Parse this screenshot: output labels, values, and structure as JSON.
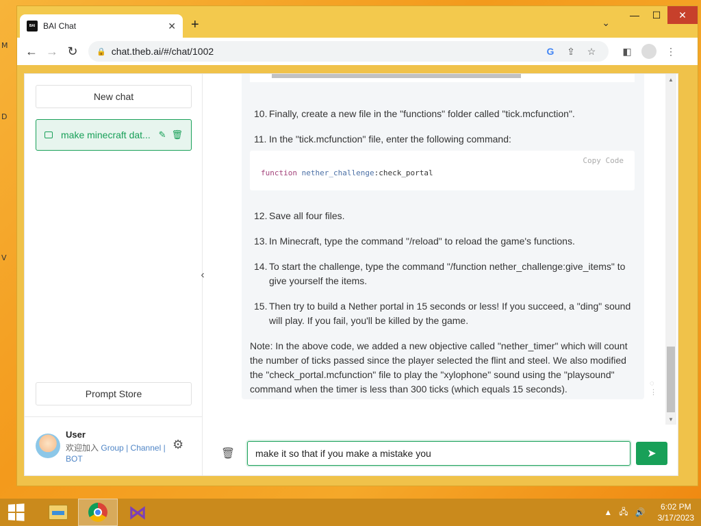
{
  "browser": {
    "tab_title": "BAI Chat",
    "tab_favicon_text": "BAI",
    "tab_close": "✕",
    "new_tab": "+",
    "tab_dropdown": "⌄",
    "win_minimize": "—",
    "win_maximize": "☐",
    "win_close": "✕",
    "url": "chat.theb.ai/#/chat/1002",
    "back": "←",
    "forward": "→",
    "reload": "↻",
    "lock": "🔒",
    "google": "G",
    "share": "⇪",
    "bookmark": "☆",
    "menu": "⋮",
    "sidepanel": "◧"
  },
  "desktop": {
    "letters": [
      "M",
      "D",
      "V"
    ]
  },
  "sidebar": {
    "new_chat": "New chat",
    "conversation_title": "make minecraft dat...",
    "edit_icon": "✎",
    "delete_icon": "🗑",
    "prompt_store": "Prompt Store",
    "user_name": "User",
    "user_prefix": "欢迎加入",
    "group_link": "Group",
    "sep1": "|",
    "channel_link": "Channel",
    "sep2": "|",
    "bot_link": "BOT",
    "settings_icon": "⚙",
    "collapse_icon": "‹"
  },
  "chat": {
    "items": [
      {
        "num": "10.",
        "text": "Finally, create a new file in the \"functions\" folder called \"tick.mcfunction\"."
      },
      {
        "num": "11.",
        "text": "In the \"tick.mcfunction\" file, enter the following command:"
      },
      {
        "num": "12.",
        "text": "Save all four files."
      },
      {
        "num": "13.",
        "text": "In Minecraft, type the command \"/reload\" to reload the game's functions."
      },
      {
        "num": "14.",
        "text": "To start the challenge, type the command \"/function nether_challenge:give_items\" to",
        "text2": "give yourself the items."
      },
      {
        "num": "15.",
        "text": "Then try to build a Nether portal in 15 seconds or less! If you succeed, a \"ding\" sound",
        "text2": "will play. If you fail, you'll be killed by the game."
      }
    ],
    "code": {
      "copy_label": "Copy Code",
      "keyword": "function",
      "namespace": "nether_challenge",
      "rest": ":check_portal"
    },
    "note_lines": [
      "Note: In the above code, we added a new objective called \"nether_timer\" which will count",
      "the number of ticks passed since the player selected the flint and steel. We also modified",
      "the \"check_portal.mcfunction\" file to play the \"xylophone\" sound using the \"playsound\"",
      "command when the timer is less than 300 ticks (which equals 15 seconds)."
    ],
    "input_value": "make it so that if you make a mistake you",
    "trash_icon": "🗑",
    "send_icon": "➤",
    "scroll_up": "▲",
    "scroll_down": "▼",
    "msg_tool_1": "◌",
    "msg_tool_2": "⋮"
  },
  "taskbar": {
    "time": "6:02 PM",
    "date": "3/17/2023",
    "tray_up": "▲",
    "network_icon": "🖧",
    "volume_icon": "🔊",
    "vs_glyph": "⋈"
  }
}
